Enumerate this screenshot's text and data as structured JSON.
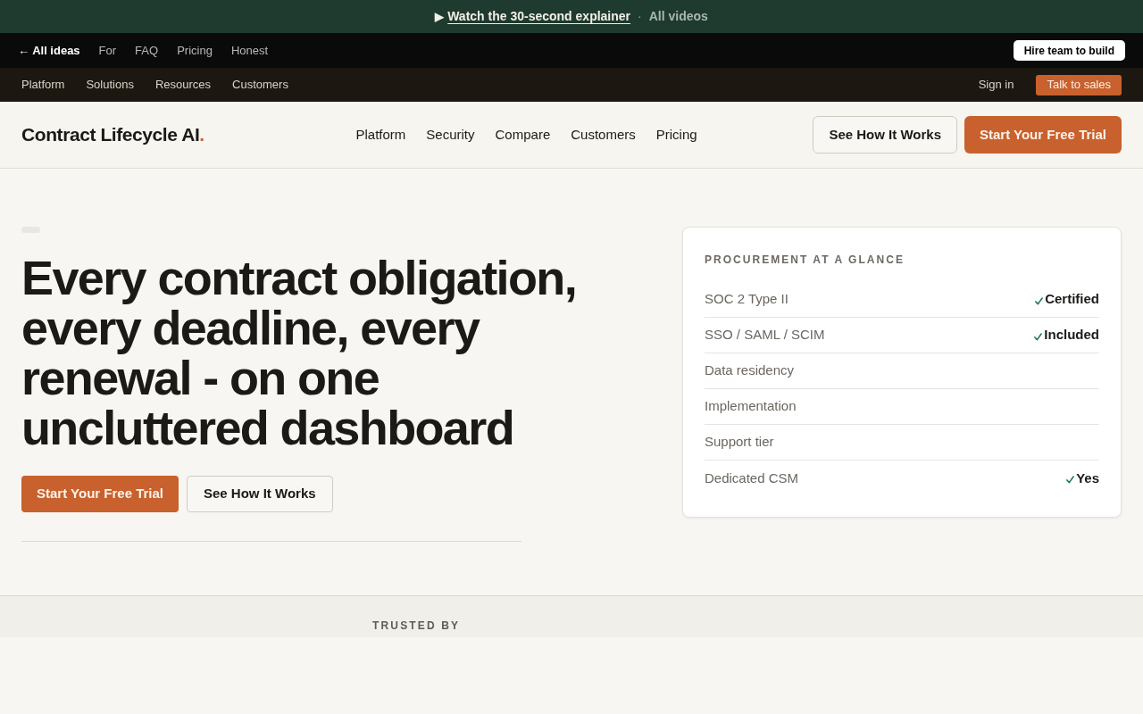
{
  "announcement": {
    "play_symbol": "▶",
    "link": "Watch the 30-second explainer",
    "separator": "·",
    "secondary_link": "All videos"
  },
  "top_bar": {
    "back_link": "← All ideas",
    "links": [
      "For",
      "FAQ",
      "Pricing",
      "Honest"
    ],
    "button": "Hire team to build"
  },
  "utility_nav": {
    "links": [
      "Platform",
      "Solutions",
      "Resources",
      "Customers"
    ],
    "sign_in": "Sign in",
    "button": "Talk to sales"
  },
  "header": {
    "logo": "Contract Lifecycle AI",
    "logo_mark": ".",
    "nav": [
      "Platform",
      "Security",
      "Compare",
      "Customers",
      "Pricing"
    ],
    "secondary_button": "See How It Works",
    "primary_button": "Start Your Free Trial"
  },
  "hero": {
    "headline": "Every contract obligation, every deadline, every renewal - on one uncluttered dashboard",
    "primary_button": "Start Your Free Trial",
    "secondary_button": "See How It Works"
  },
  "glance_card": {
    "title": "PROCUREMENT AT A GLANCE",
    "rows": [
      {
        "label": "SOC 2 Type II",
        "check": true,
        "value": "Certified"
      },
      {
        "label": "SSO / SAML / SCIM",
        "check": true,
        "value": "Included"
      },
      {
        "label": "Data residency",
        "check": false
      },
      {
        "label": "Implementation",
        "check": false
      },
      {
        "label": "Support tier",
        "check": false
      },
      {
        "label": "Dedicated CSM",
        "check": true,
        "value": "Yes"
      }
    ]
  },
  "trusted": {
    "label": "TRUSTED BY"
  }
}
